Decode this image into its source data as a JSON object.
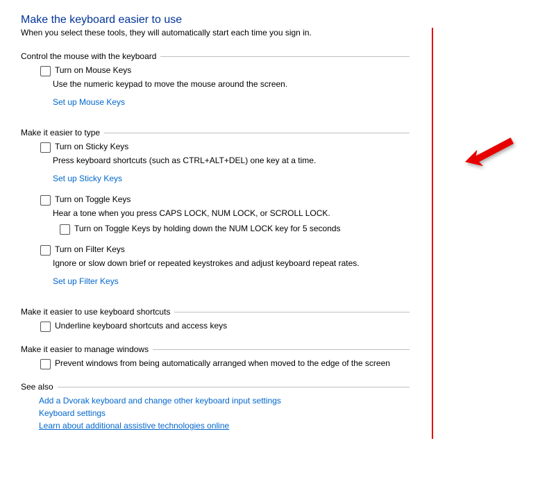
{
  "title": "Make the keyboard easier to use",
  "subtitle": "When you select these tools, they will automatically start each time you sign in.",
  "sections": {
    "mouse": {
      "title": "Control the mouse with the keyboard",
      "mouseKeys": "Turn on Mouse Keys",
      "mouseDesc": "Use the numeric keypad to move the mouse around the screen.",
      "mouseLink": "Set up Mouse Keys"
    },
    "type": {
      "title": "Make it easier to type",
      "sticky": "Turn on Sticky Keys",
      "stickyDesc": "Press keyboard shortcuts (such as CTRL+ALT+DEL) one key at a time.",
      "stickyLink": "Set up Sticky Keys",
      "toggle": "Turn on Toggle Keys",
      "toggleDesc": "Hear a tone when you press CAPS LOCK, NUM LOCK, or SCROLL LOCK.",
      "toggleHold": "Turn on Toggle Keys by holding down the NUM LOCK key for 5 seconds",
      "filter": "Turn on Filter Keys",
      "filterDesc": "Ignore or slow down brief or repeated keystrokes and adjust keyboard repeat rates.",
      "filterLink": "Set up Filter Keys"
    },
    "shortcuts": {
      "title": "Make it easier to use keyboard shortcuts",
      "underline": "Underline keyboard shortcuts and access keys"
    },
    "windows": {
      "title": "Make it easier to manage windows",
      "prevent": "Prevent windows from being automatically arranged when moved to the edge of the screen"
    },
    "seeAlso": {
      "title": "See also",
      "dvorak": "Add a Dvorak keyboard and change other keyboard input settings",
      "kb": "Keyboard settings",
      "learn": "Learn about additional assistive technologies online"
    }
  }
}
